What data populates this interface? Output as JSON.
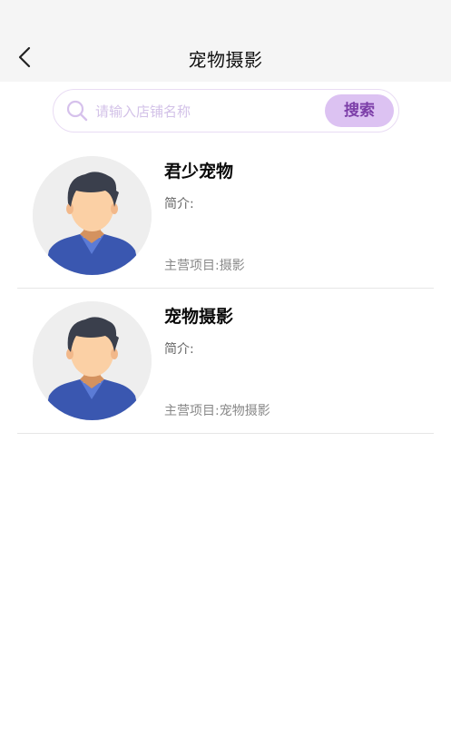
{
  "header": {
    "title": "宠物摄影",
    "back_icon": "chevron-left-icon"
  },
  "search": {
    "placeholder": "请输入店铺名称",
    "value": "",
    "button_label": "搜索",
    "icon": "search-icon"
  },
  "colors": {
    "accent": "#dcc2f2",
    "accent_text": "#7c3ea8",
    "header_bg": "#f5f5f5"
  },
  "stores": [
    {
      "name": "君少宠物",
      "intro_label": "简介:",
      "intro": "",
      "business_label": "主营项目:",
      "business": "摄影",
      "avatar": "male-avatar-icon"
    },
    {
      "name": "宠物摄影",
      "intro_label": "简介:",
      "intro": "",
      "business_label": "主营项目:",
      "business": "宠物摄影",
      "avatar": "male-avatar-icon"
    }
  ]
}
